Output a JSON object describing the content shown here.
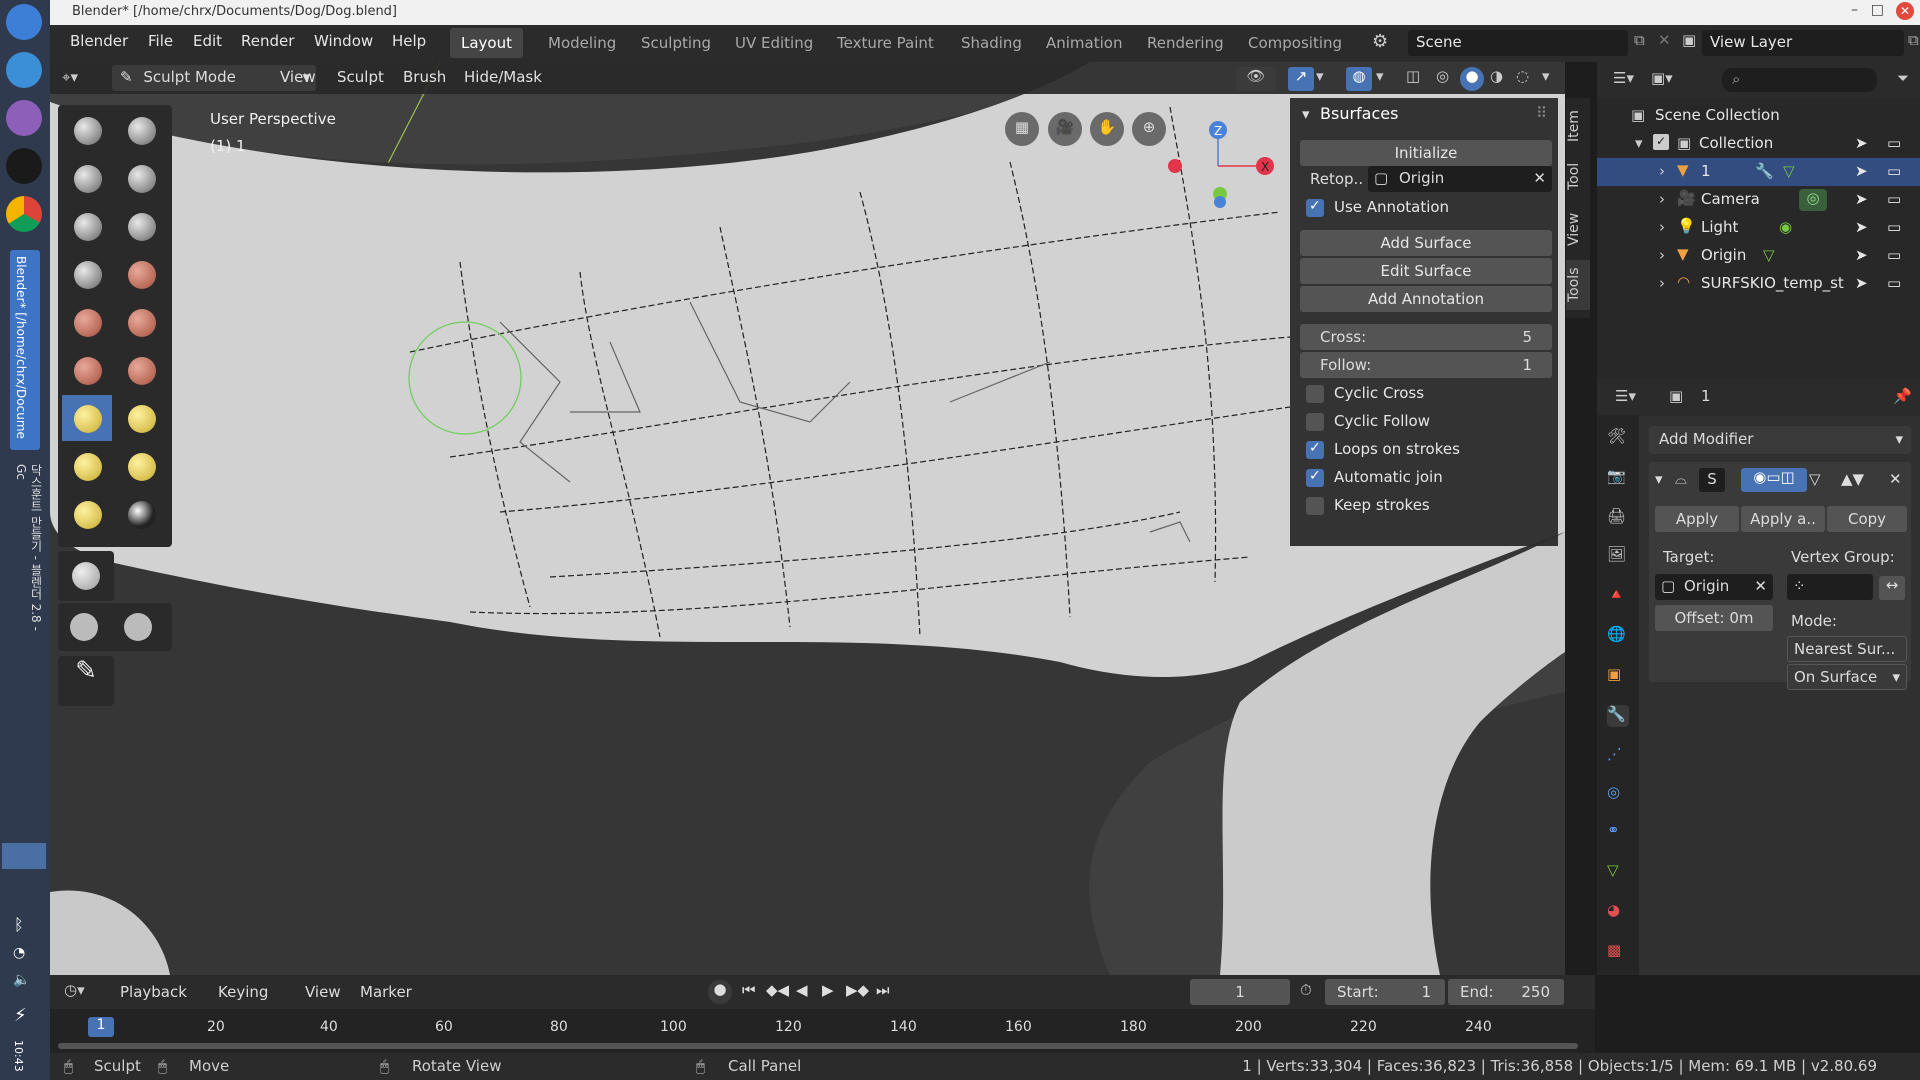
{
  "window": {
    "title": "Blender* [/home/chrx/Documents/Dog/Dog.blend]"
  },
  "os_sidebar": {
    "taskbar_label": "Blender* [/home/chrx/Docume",
    "clock": "10:43",
    "extra_label": "닥스훈트 만들기 - 블렌더 2.8 - Gc"
  },
  "menus": [
    "Blender",
    "File",
    "Edit",
    "Render",
    "Window",
    "Help"
  ],
  "workspaces": [
    "Layout",
    "Modeling",
    "Sculpting",
    "UV Editing",
    "Texture Paint",
    "Shading",
    "Animation",
    "Rendering",
    "Compositing"
  ],
  "active_workspace": "Layout",
  "scene": {
    "label": "Scene"
  },
  "view_layer": {
    "label": "View Layer"
  },
  "viewport": {
    "mode": "Sculpt Mode",
    "menus": [
      "View",
      "Sculpt",
      "Brush",
      "Hide/Mask"
    ],
    "perspective": "User Perspective",
    "object_info": "(1) 1",
    "axis_labels": {
      "z": "Z",
      "x": "X"
    }
  },
  "bsurfaces": {
    "title": "Bsurfaces",
    "initialize": "Initialize",
    "retop_label": "Retop..",
    "retop_value": "Origin",
    "use_annotation": "Use Annotation",
    "add_surface": "Add Surface",
    "edit_surface": "Edit Surface",
    "add_annotation": "Add Annotation",
    "cross_label": "Cross:",
    "cross_value": "5",
    "follow_label": "Follow:",
    "follow_value": "1",
    "options": [
      {
        "label": "Cyclic Cross",
        "checked": false
      },
      {
        "label": "Cyclic Follow",
        "checked": false
      },
      {
        "label": "Loops on strokes",
        "checked": true
      },
      {
        "label": "Automatic join",
        "checked": true
      },
      {
        "label": "Keep strokes",
        "checked": false
      }
    ]
  },
  "side_tabs": [
    "Item",
    "Tool",
    "View",
    "Tools"
  ],
  "outliner": {
    "root": "Scene Collection",
    "collection": "Collection",
    "items": [
      {
        "name": "1",
        "selected": true
      },
      {
        "name": "Camera",
        "selected": false
      },
      {
        "name": "Light",
        "selected": false
      },
      {
        "name": "Origin",
        "selected": false
      },
      {
        "name": "SURFSKIO_temp_st",
        "selected": false
      }
    ]
  },
  "properties": {
    "object_name": "1",
    "add_modifier": "Add Modifier",
    "modifier_name": "S",
    "apply": "Apply",
    "apply_as": "Apply a..",
    "copy": "Copy",
    "target_label": "Target:",
    "target_value": "Origin",
    "vertex_group_label": "Vertex Group:",
    "offset": "Offset: 0m",
    "mode_label": "Mode:",
    "mode_value": "Nearest Sur...",
    "on_surface": "On Surface"
  },
  "timeline": {
    "menus": [
      "Playback",
      "Keying",
      "View",
      "Marker"
    ],
    "current_frame": "1",
    "start_label": "Start:",
    "start_value": "1",
    "end_label": "End:",
    "end_value": "250",
    "ticks": [
      "1",
      "20",
      "40",
      "60",
      "80",
      "100",
      "120",
      "140",
      "160",
      "180",
      "200",
      "220",
      "240"
    ]
  },
  "status_bar": {
    "sculpt": "Sculpt",
    "move": "Move",
    "rotate": "Rotate View",
    "call_panel": "Call Panel",
    "stats": "1 | Verts:33,304 | Faces:36,823 | Tris:36,858 | Objects:1/5 | Mem: 69.1 MB | v2.80.69"
  },
  "colors": {
    "accent": "#4772b3",
    "selection": "#334d80",
    "header_bg": "#2b2b2b",
    "panel_bg": "#2d2d2d"
  }
}
